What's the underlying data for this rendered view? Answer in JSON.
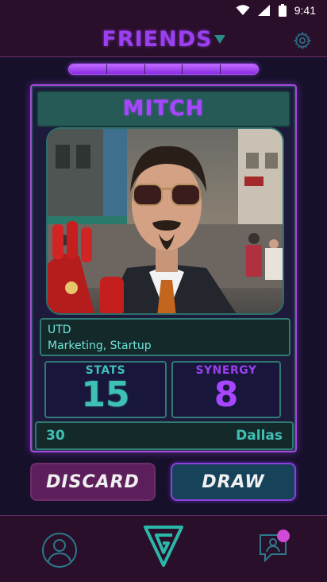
{
  "status": {
    "time": "9:41"
  },
  "header": {
    "title": "FRIENDS"
  },
  "progress": {
    "segments": 5,
    "filled": 5
  },
  "card": {
    "name": "MITCH",
    "school": "UTD",
    "interests": "Marketing, Startup",
    "stats_label": "STATS",
    "stats_value": "15",
    "synergy_label": "SYNERGY",
    "synergy_value": "8",
    "age": "30",
    "city": "Dallas"
  },
  "actions": {
    "discard": "DISCARD",
    "draw": "DRAW"
  },
  "nav": {
    "items": [
      {
        "icon": "profile-icon"
      },
      {
        "icon": "logo-icon"
      },
      {
        "icon": "chat-icon",
        "has_notification": true
      }
    ]
  },
  "colors": {
    "background": "#17102b",
    "header": "#2a0f2b",
    "purple_accent": "#a646ff",
    "teal_accent": "#3fc0b4",
    "notification": "#d04ad8"
  }
}
